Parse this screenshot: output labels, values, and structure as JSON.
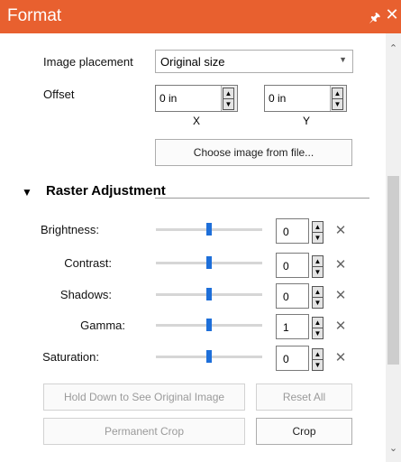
{
  "title": "Format",
  "title_icons": {
    "pin": "pin-icon",
    "close": "close-icon"
  },
  "colors": {
    "accent": "#E8602F",
    "slider_thumb": "#1e6fd9"
  },
  "image": {
    "placement_label": "Image placement",
    "placement_value": "Original size",
    "offset_label": "Offset",
    "offset_x": "0 in",
    "offset_y": "0 in",
    "x_label": "X",
    "y_label": "Y",
    "choose_button": "Choose image from file..."
  },
  "raster": {
    "title": "Raster Adjustment",
    "rows": [
      {
        "label": "Brightness:",
        "value": "0",
        "level": 0.5
      },
      {
        "label": "Contrast:",
        "value": "0",
        "level": 0.5
      },
      {
        "label": "Shadows:",
        "value": "0",
        "level": 0.5
      },
      {
        "label": "Gamma:",
        "value": "1",
        "level": 0.5
      },
      {
        "label": "Saturation:",
        "value": "0",
        "level": 0.5
      }
    ],
    "hold_button": "Hold Down to See Original Image",
    "reset_button": "Reset All",
    "permanent_crop_button": "Permanent Crop",
    "crop_button": "Crop"
  }
}
